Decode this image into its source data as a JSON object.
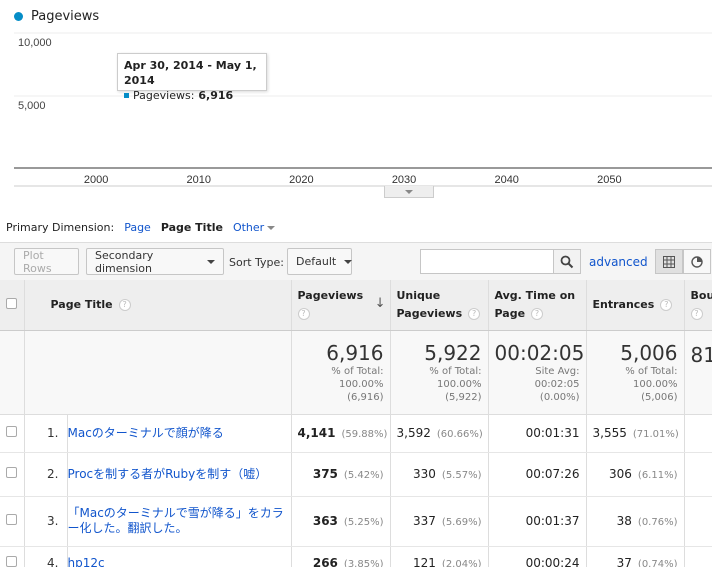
{
  "chart_data": {
    "type": "line",
    "series": [
      {
        "name": "Pageviews",
        "color": "#058dc7",
        "points": [
          {
            "x": 2014.33,
            "y": 6916
          }
        ]
      }
    ],
    "x_ticks": [
      "2000",
      "2010",
      "2020",
      "2030",
      "2040",
      "2050"
    ],
    "y_ticks": [
      "10,000",
      "5,000"
    ],
    "xlim": [
      1992,
      2060
    ],
    "ylim": [
      0,
      10000
    ],
    "legend": "Pageviews",
    "tooltip": {
      "date": "Apr 30, 2014 - May 1, 2014",
      "label": "Pageviews:",
      "value": "6,916"
    }
  },
  "dimension_bar": {
    "label": "Primary Dimension:",
    "options": [
      "Page",
      "Page Title",
      "Other"
    ],
    "active": "Page Title"
  },
  "toolbar": {
    "plot_rows": "Plot Rows",
    "secondary_dimension": "Secondary dimension",
    "sort_type_label": "Sort Type:",
    "sort_type_value": "Default",
    "search_placeholder": "",
    "advanced": "advanced"
  },
  "table": {
    "headers": {
      "page_title": "Page Title",
      "pageviews": "Pageviews",
      "unique_l1": "Unique",
      "unique_l2": "Pageviews",
      "avg_l1": "Avg. Time on",
      "avg_l2": "Page",
      "entrances": "Entrances",
      "bounce": "Bour"
    },
    "summary": {
      "pageviews": {
        "value": "6,916",
        "l1": "% of Total:",
        "l2": "100.00%",
        "l3": "(6,916)"
      },
      "unique": {
        "value": "5,922",
        "l1": "% of Total:",
        "l2": "100.00%",
        "l3": "(5,922)"
      },
      "avg_time": {
        "value": "00:02:05",
        "l1": "Site Avg:",
        "l2": "00:02:05",
        "l3": "(0.00%)"
      },
      "entrances": {
        "value": "5,006",
        "l1": "% of Total:",
        "l2": "100.00%",
        "l3": "(5,006)"
      },
      "bounce": {
        "value": "81"
      }
    },
    "rows": [
      {
        "idx": "1.",
        "title": "Macのターミナルで顔が降る",
        "pv": "4,141",
        "pv_pct": "(59.88%)",
        "upv": "3,592",
        "upv_pct": "(60.66%)",
        "avg": "00:01:31",
        "ent": "3,555",
        "ent_pct": "(71.01%)"
      },
      {
        "idx": "2.",
        "title": "Procを制する者がRubyを制す（嘘）",
        "pv": "375",
        "pv_pct": "(5.42%)",
        "upv": "330",
        "upv_pct": "(5.57%)",
        "avg": "00:07:26",
        "ent": "306",
        "ent_pct": "(6.11%)"
      },
      {
        "idx": "3.",
        "title": "「Macのターミナルで雪が降る」をカラー化した。翻訳した。",
        "pv": "363",
        "pv_pct": "(5.25%)",
        "upv": "337",
        "upv_pct": "(5.69%)",
        "avg": "00:01:37",
        "ent": "38",
        "ent_pct": "(0.76%)"
      },
      {
        "idx": "4.",
        "title": "hp12c",
        "pv": "266",
        "pv_pct": "(3.85%)",
        "upv": "121",
        "upv_pct": "(2.04%)",
        "avg": "00:00:24",
        "ent": "37",
        "ent_pct": "(0.74%)"
      }
    ]
  }
}
